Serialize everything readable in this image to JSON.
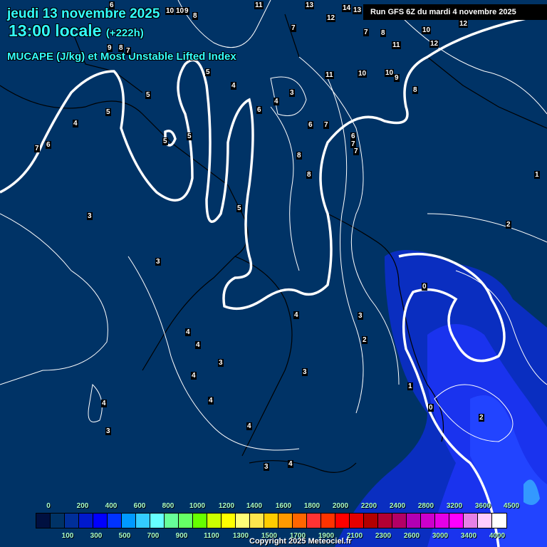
{
  "header": {
    "date": "jeudi 13 novembre 2025",
    "time": "13:00 locale",
    "offset": "(+222h)",
    "parameter": "MUCAPE (J/kg) et Most Unstable Lifted Index"
  },
  "run": "Run GFS 6Z du mardi 4 novembre 2025",
  "copyright": "Copyright 2025 Meteociel.fr",
  "legend": {
    "top_labels": [
      "0",
      "200",
      "400",
      "600",
      "800",
      "1000",
      "1200",
      "1400",
      "1600",
      "1800",
      "2000",
      "2200",
      "2400",
      "2800",
      "3200",
      "3600",
      "4500"
    ],
    "bottom_labels": [
      "100",
      "300",
      "500",
      "700",
      "900",
      "1100",
      "1300",
      "1500",
      "1700",
      "1900",
      "2100",
      "2300",
      "2600",
      "3000",
      "3400",
      "4000"
    ],
    "colors": [
      "#001040",
      "#003366",
      "#002f99",
      "#0019cc",
      "#0000ff",
      "#0033ff",
      "#0099ff",
      "#33ccff",
      "#66ffff",
      "#66ff99",
      "#66ff66",
      "#66ff00",
      "#ccff00",
      "#ffff00",
      "#ffff77",
      "#ffe64d",
      "#ffcc00",
      "#ff9900",
      "#ff6600",
      "#ff3333",
      "#ff3300",
      "#ff0000",
      "#e60000",
      "#b30000",
      "#b30033",
      "#b30066",
      "#b300b3",
      "#cc00cc",
      "#e600e6",
      "#ff00ff",
      "#e680e6",
      "#ffccff",
      "#ffffff"
    ]
  },
  "lifted_index_labels": [
    "6",
    "10",
    "10",
    "9",
    "8",
    "11",
    "13",
    "14",
    "13",
    "12",
    "7",
    "7",
    "8",
    "10",
    "12",
    "11",
    "12",
    "5",
    "9",
    "8",
    "7",
    "4",
    "3",
    "4",
    "6",
    "6",
    "7",
    "11",
    "10",
    "10",
    "9",
    "8",
    "5",
    "5",
    "4",
    "7",
    "6",
    "5",
    "5",
    "6",
    "7",
    "8",
    "7",
    "8",
    "1",
    "2",
    "3",
    "5",
    "3",
    "0",
    "3",
    "2",
    "4",
    "4",
    "4",
    "3",
    "4",
    "3",
    "1",
    "0",
    "2",
    "4",
    "4",
    "3",
    "4",
    "3",
    "4"
  ],
  "colors": {
    "background": "#003366",
    "title": "#33ffff",
    "cape_low": "#0033cc",
    "cape_mid": "#0022ff"
  }
}
